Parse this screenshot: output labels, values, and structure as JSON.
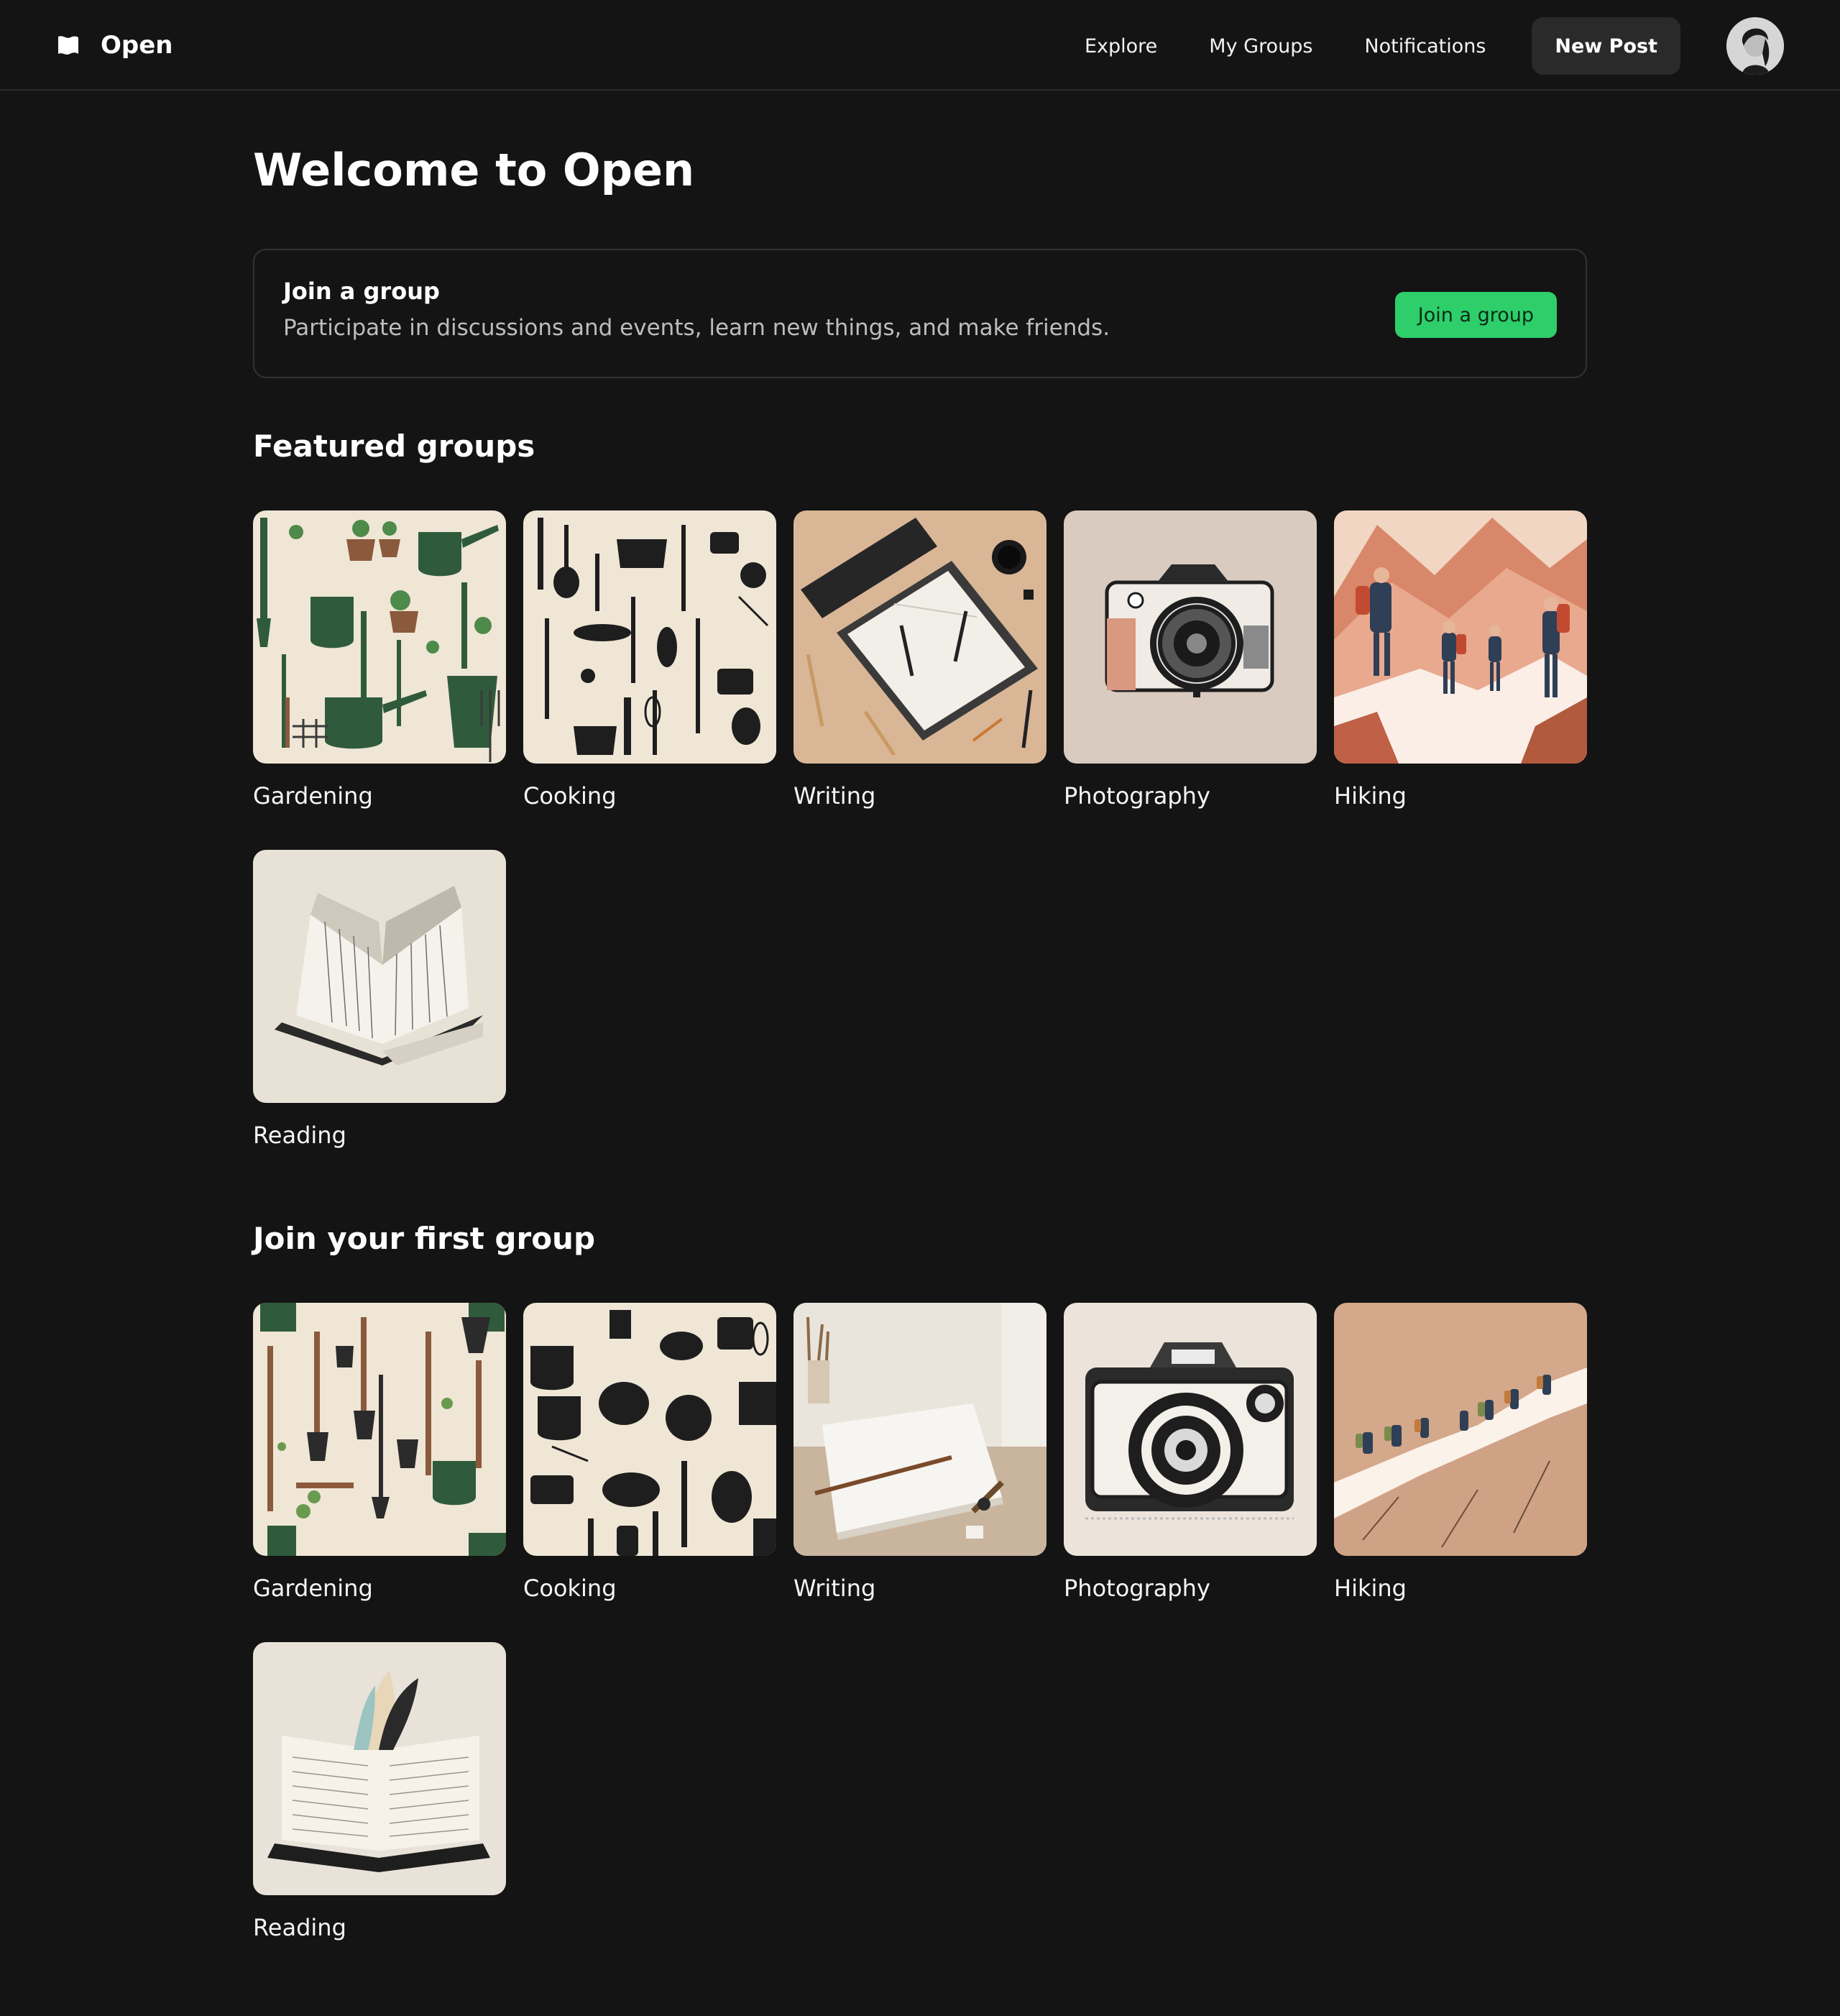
{
  "header": {
    "brand": "Open",
    "nav": [
      "Explore",
      "My Groups",
      "Notifications"
    ],
    "new_post": "New Post"
  },
  "main": {
    "title": "Welcome to Open",
    "join_card": {
      "title": "Join a group",
      "description": "Participate in discussions and events, learn new things, and make friends.",
      "button": "Join a group"
    },
    "featured": {
      "title": "Featured groups",
      "groups": [
        "Gardening",
        "Cooking",
        "Writing",
        "Photography",
        "Hiking",
        "Reading"
      ]
    },
    "first_group": {
      "title": "Join your first group",
      "groups": [
        "Gardening",
        "Cooking",
        "Writing",
        "Photography",
        "Hiking",
        "Reading"
      ]
    }
  },
  "colors": {
    "background": "#141414",
    "accent_green": "#2ecf6a",
    "button_dark": "#2a2a2a"
  },
  "icons": {
    "logo": "flag-icon"
  }
}
